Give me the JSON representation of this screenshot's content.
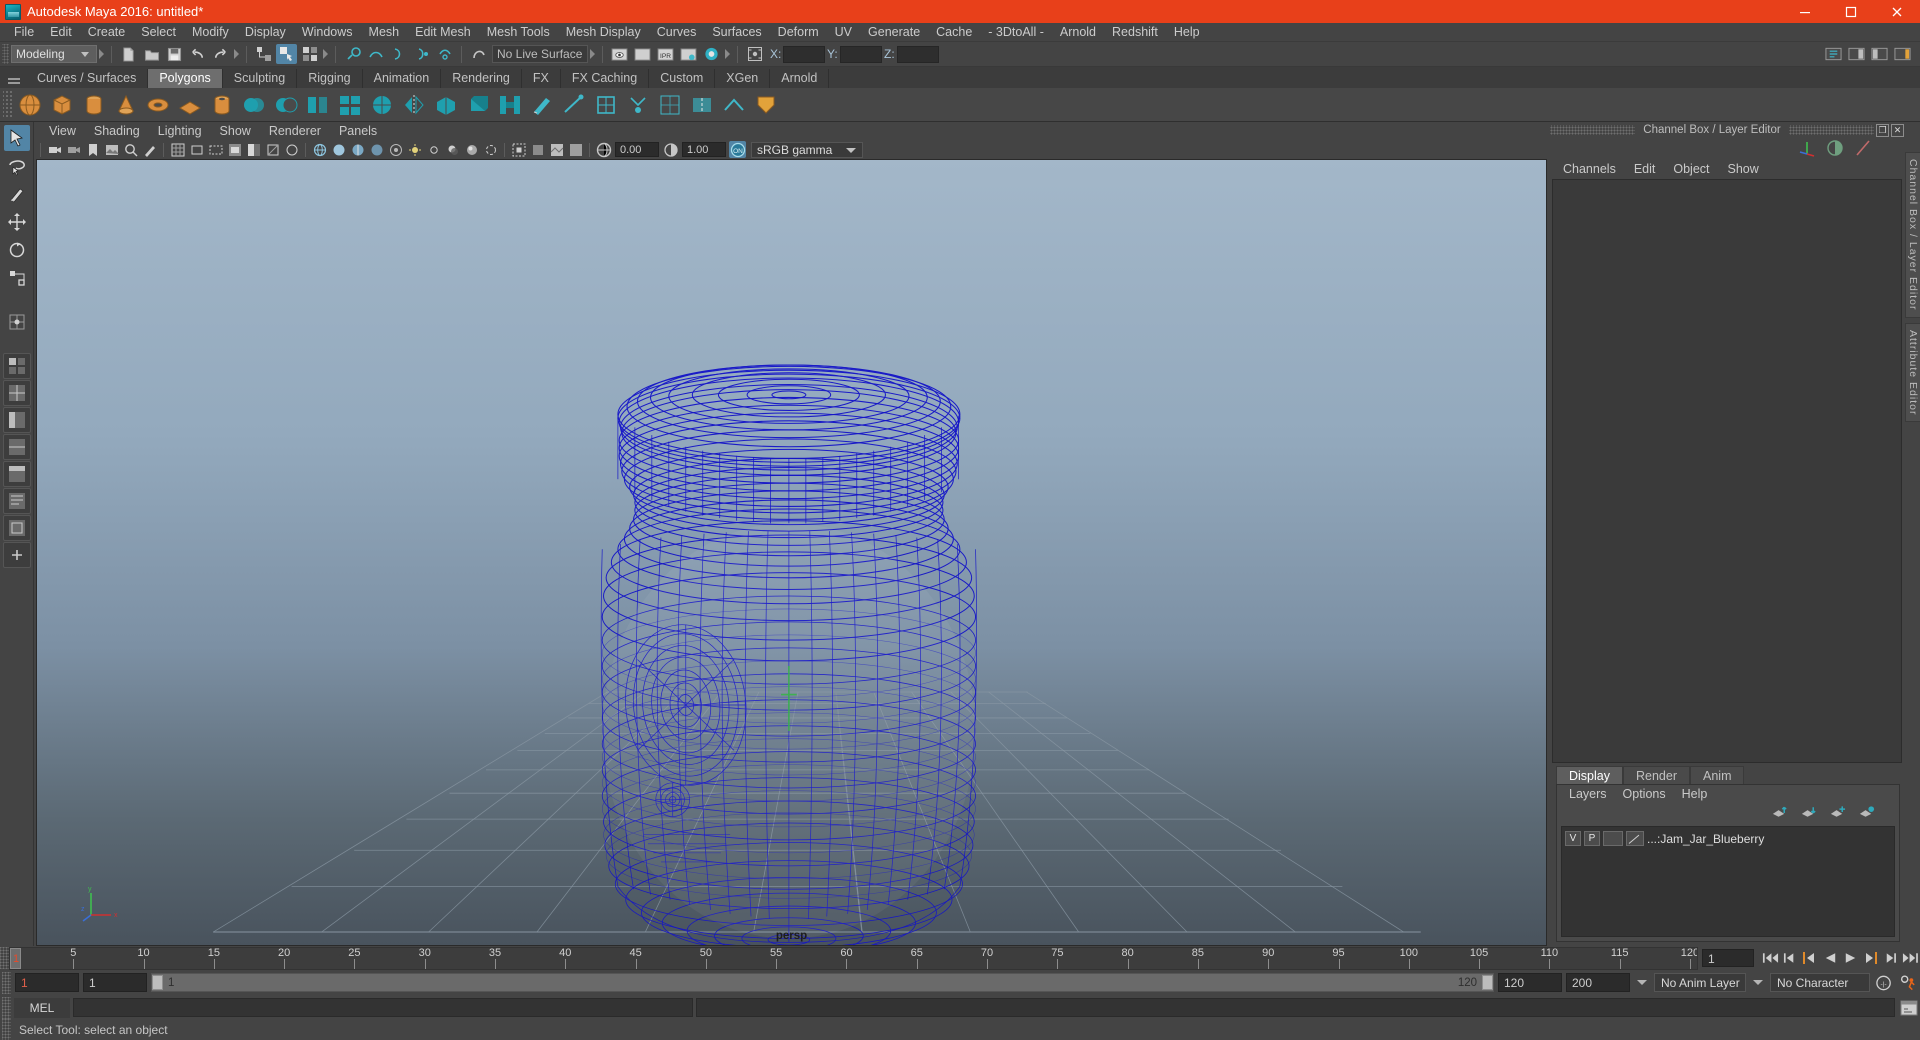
{
  "window": {
    "title": "Autodesk Maya 2016: untitled*",
    "minimize": "–",
    "maximize": "❐",
    "close": "✕",
    "accent_color": "#e8401a"
  },
  "menubar": {
    "items": [
      "File",
      "Edit",
      "Create",
      "Select",
      "Modify",
      "Display",
      "Windows",
      "Mesh",
      "Edit Mesh",
      "Mesh Tools",
      "Mesh Display",
      "Curves",
      "Surfaces",
      "Deform",
      "UV",
      "Generate",
      "Cache",
      "- 3DtoAll -",
      "Arnold",
      "Redshift",
      "Help"
    ]
  },
  "statusline": {
    "mode": "Modeling",
    "live_surface": "No Live Surface",
    "x_label": "X:",
    "y_label": "Y:",
    "z_label": "Z:",
    "x_value": "",
    "y_value": "",
    "z_value": "",
    "ipr_label": "IPR"
  },
  "shelf": {
    "tabs": [
      "Curves / Surfaces",
      "Polygons",
      "Sculpting",
      "Rigging",
      "Animation",
      "Rendering",
      "FX",
      "FX Caching",
      "Custom",
      "XGen",
      "Arnold"
    ],
    "active_tab": "Polygons"
  },
  "viewport": {
    "panel_menu": [
      "View",
      "Shading",
      "Lighting",
      "Show",
      "Renderer",
      "Panels"
    ],
    "exposure_value": "0.00",
    "gamma_value": "1.00",
    "color_management": "sRGB gamma",
    "camera_label": "persp",
    "axis_x": "x",
    "axis_y": "y",
    "axis_z": "z"
  },
  "channelbox": {
    "title": "Channel Box / Layer Editor",
    "restore_glyph": "❐",
    "close_glyph": "✕",
    "menu": [
      "Channels",
      "Edit",
      "Object",
      "Show"
    ]
  },
  "layer_editor": {
    "tabs": [
      "Display",
      "Render",
      "Anim"
    ],
    "active_tab": "Display",
    "menu": [
      "Layers",
      "Options",
      "Help"
    ],
    "layers": [
      {
        "visible": "V",
        "playback": "P",
        "name": "...:Jam_Jar_Blueberry"
      }
    ]
  },
  "side_tabs": [
    "Channel Box / Layer Editor",
    "Attribute Editor"
  ],
  "timeline": {
    "ticks": [
      5,
      10,
      15,
      20,
      25,
      30,
      35,
      40,
      45,
      50,
      55,
      60,
      65,
      70,
      75,
      80,
      85,
      90,
      95,
      100,
      105,
      110,
      115,
      120
    ],
    "current_frame": "1",
    "current_frame_field": "1",
    "range_start": "1",
    "range_start_alt": "1",
    "slider_start": "1",
    "slider_end": "120",
    "range_end": "120",
    "playback_end": "200",
    "anim_layer": "No Anim Layer",
    "character_set": "No Character Set"
  },
  "command_line": {
    "language": "MEL",
    "input_value": "",
    "output_value": ""
  },
  "help_line": {
    "text": "Select Tool: select an object"
  }
}
